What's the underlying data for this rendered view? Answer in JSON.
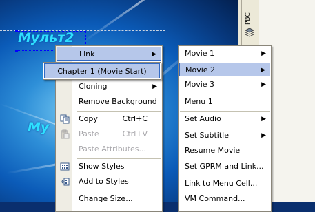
{
  "canvas": {
    "text_top": "Мульт2",
    "text_bottom": "Му"
  },
  "toolstrip": {
    "pbc_label": "PBC",
    "stack_icon": "stack-layers-icon"
  },
  "main_menu": {
    "items": [
      {
        "label": "Link",
        "submenu": true,
        "highlighted": true
      },
      {
        "label": "Cloning",
        "submenu": true
      },
      {
        "label": "Remove Background"
      },
      {
        "label": "Copy",
        "shortcut": "Ctrl+C",
        "icon": "copy-icon"
      },
      {
        "label": "Paste",
        "shortcut": "Ctrl+V",
        "icon": "paste-icon",
        "disabled": true
      },
      {
        "label": "Paste Attributes...",
        "disabled": true
      },
      {
        "label": "Show Styles",
        "icon": "styles-grid-icon"
      },
      {
        "label": "Add to Styles",
        "icon": "add-styles-icon"
      },
      {
        "label": "Change Size..."
      }
    ]
  },
  "chapter_menu": {
    "item": "Chapter 1 (Movie Start)"
  },
  "link_submenu": {
    "items": [
      {
        "label": "Movie 1",
        "submenu": true
      },
      {
        "label": "Movie 2",
        "submenu": true,
        "highlighted": true
      },
      {
        "label": "Movie 3",
        "submenu": true
      },
      {
        "label": "Menu 1"
      },
      {
        "label": "Set Audio",
        "submenu": true
      },
      {
        "label": "Set Subtitle",
        "submenu": true
      },
      {
        "label": "Resume Movie"
      },
      {
        "label": "Set GPRM and Link..."
      },
      {
        "label": "Link to Menu Cell..."
      },
      {
        "label": "VM Command..."
      }
    ]
  },
  "colors": {
    "highlight": "#b6c7ea",
    "highlight_border": "#316ac5",
    "canvas_text": "#2ee0ff",
    "selection": "#0000ff"
  }
}
